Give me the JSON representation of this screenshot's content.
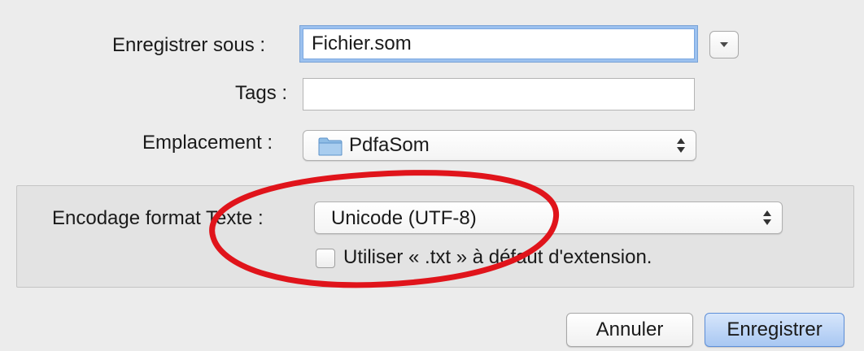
{
  "save_as": {
    "label": "Enregistrer sous :",
    "value": "Fichier.som"
  },
  "tags": {
    "label": "Tags :",
    "value": ""
  },
  "location": {
    "label": "Emplacement :",
    "value": "PdfaSom",
    "icon": "folder-icon"
  },
  "encoding": {
    "label": "Encodage format Texte :",
    "value": "Unicode (UTF-8)"
  },
  "use_txt": {
    "label": "Utiliser « .txt » à défaut d'extension.",
    "checked": false
  },
  "buttons": {
    "cancel": "Annuler",
    "save": "Enregistrer"
  },
  "colors": {
    "annotation_ellipse": "#e0141b",
    "default_button": "#a8c7f2",
    "focus_ring": "#9cc1ef"
  }
}
